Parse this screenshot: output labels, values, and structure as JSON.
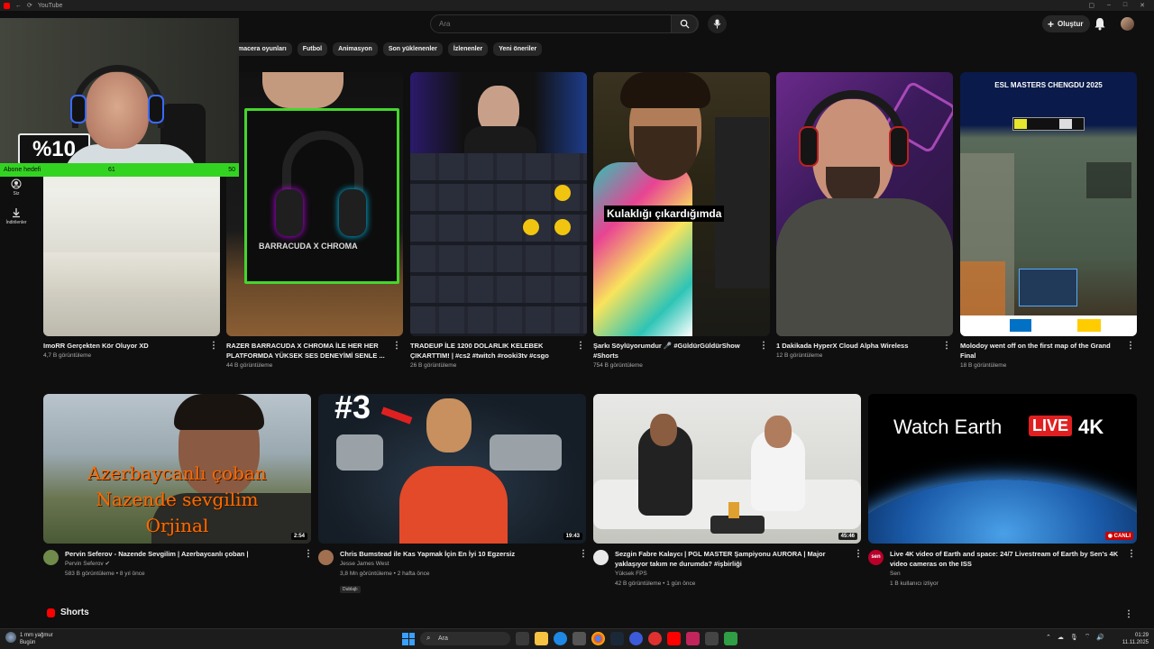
{
  "window": {
    "title": "YouTube"
  },
  "topbar": {
    "search_placeholder": "Ara",
    "create_label": "Oluştur"
  },
  "chips": [
    "macera oyunları",
    "Futbol",
    "Animasyon",
    "Son yüklenenler",
    "İzlenenler",
    "Yeni öneriler"
  ],
  "sidebar": {
    "items": [
      {
        "label": "Siz",
        "icon": "user-circle-icon"
      },
      {
        "label": "İndirilenler",
        "icon": "download-icon"
      }
    ]
  },
  "webcam_overlay": {
    "sign_text": "%10",
    "goal": {
      "label": "Abone hedefi",
      "current": "61",
      "target": "50"
    }
  },
  "row1": [
    {
      "title": "ImoRR Gerçekten Kör Oluyor XD",
      "views": "4,7 B görüntüleme",
      "thumb_text": ""
    },
    {
      "title": "RAZER BARRACUDA X CHROMA İLE HER HER PLATFORMDA YÜKSEK SES DENEYİMİ SENLE ...",
      "views": "44 B görüntüleme",
      "thumb_text": "BARRACUDA X CHROMA"
    },
    {
      "title": "TRADEUP İLE 1200 DOLARLIK KELEBEK ÇIKARTTIM! | #cs2 #twitch #rooki3tv #csgo",
      "views": "26 B görüntüleme",
      "thumb_text": ""
    },
    {
      "title": "Şarkı Söylüyorumdur 🎤 #GüldürGüldürShow #Shorts",
      "views": "754 B görüntüleme",
      "thumb_text": "Kulaklığı çıkardığımda"
    },
    {
      "title": "1 Dakikada HyperX Cloud Alpha Wireless",
      "views": "12 B görüntüleme",
      "thumb_text": ""
    },
    {
      "title": "Molodoy went off on the first map of the Grand Final",
      "views": "18 B görüntüleme",
      "thumb_text": "ESL MASTERS CHENGDU 2025"
    }
  ],
  "row2": [
    {
      "title": "Pervin Seferov - Nazende Sevgilim | Azerbaycanlı çoban |",
      "channel": "Pervin Seferov",
      "meta": "583 B görüntüleme • 8 yıl önce",
      "duration": "2:54",
      "thumb_lines": [
        "Azerbaycanlı çoban",
        "Nazende sevgilim",
        "Orjinal"
      ],
      "avatar_color": "#6f8a4a"
    },
    {
      "title": "Chris Bumstead ile Kas Yapmak İçin En İyi 10 Egzersiz",
      "channel": "Jesse James West",
      "meta": "3,8 Mn görüntüleme • 2 hafta önce",
      "duration": "19:43",
      "thumb_text": "#3",
      "badge": "Dublajlı",
      "avatar_color": "#a07050"
    },
    {
      "title": "Sezgin Fabre Kalaycı | PGL MASTER Şampiyonu AURORA | Major yaklaşıyor takım ne durumda? #işbirliği",
      "channel": "Yüksek FPS",
      "meta": "42 B görüntüleme • 1 gün önce",
      "duration": "45:46",
      "avatar_color": "#e8e8e8"
    },
    {
      "title": "Live 4K video of Earth and space: 24/7 Livestream of Earth by Sen's 4K video cameras on the ISS",
      "channel": "Sen",
      "meta": "1 B kullanıcı izliyor",
      "live_label": "CANLI",
      "thumb_text": "Watch Earth",
      "thumb_live": "LIVE",
      "thumb_4k": "4K",
      "avatar_label": "sen",
      "avatar_color": "#b8002a"
    }
  ],
  "shorts": {
    "label": "Shorts"
  },
  "taskbar": {
    "weather_line1": "1 mm yağmur",
    "weather_line2": "Bugün",
    "search_label": "Ara",
    "time": "01:29",
    "date": "11.11.2025"
  },
  "colors": {
    "accent_red": "#ff0000",
    "goal_green": "#33d421",
    "background": "#0f0f0f"
  }
}
